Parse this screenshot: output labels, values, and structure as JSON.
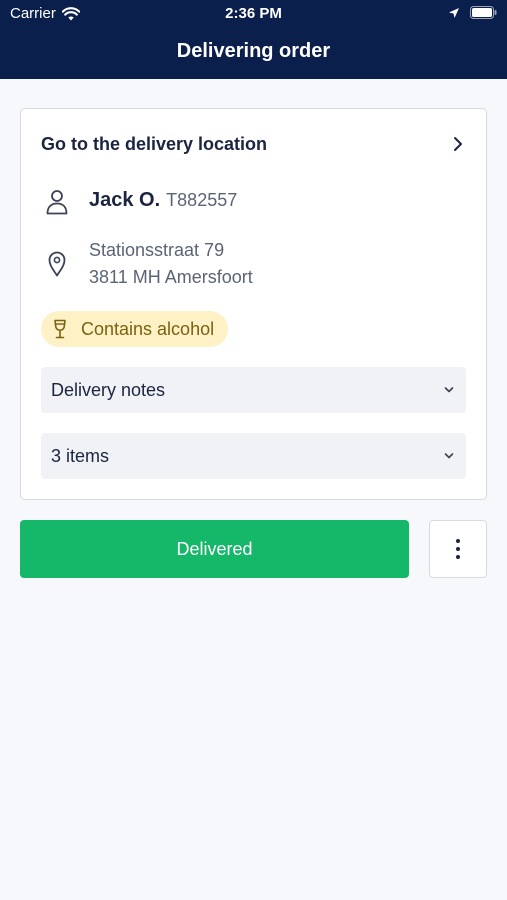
{
  "status_bar": {
    "carrier": "Carrier",
    "time": "2:36 PM",
    "icons": [
      "wifi-icon",
      "location-arrow-icon",
      "battery-icon"
    ]
  },
  "nav": {
    "title": "Delivering order"
  },
  "card": {
    "title": "Go to the delivery location",
    "customer": {
      "name": "Jack O.",
      "ref": "T882557"
    },
    "address": {
      "line1": "Stationsstraat 79",
      "line2": "3811 MH Amersfoort"
    },
    "badge": {
      "label": "Contains alcohol",
      "icon": "wine-glass-icon"
    },
    "accordions": [
      {
        "label": "Delivery notes"
      },
      {
        "label": "3 items"
      }
    ]
  },
  "actions": {
    "primary_label": "Delivered",
    "more_icon": "more-vertical-icon"
  },
  "colors": {
    "header_bg": "#0b1f4d",
    "primary": "#15b768",
    "badge_bg": "#fdf1c5",
    "badge_text": "#7a6210",
    "page_bg": "#f6f8fb"
  }
}
